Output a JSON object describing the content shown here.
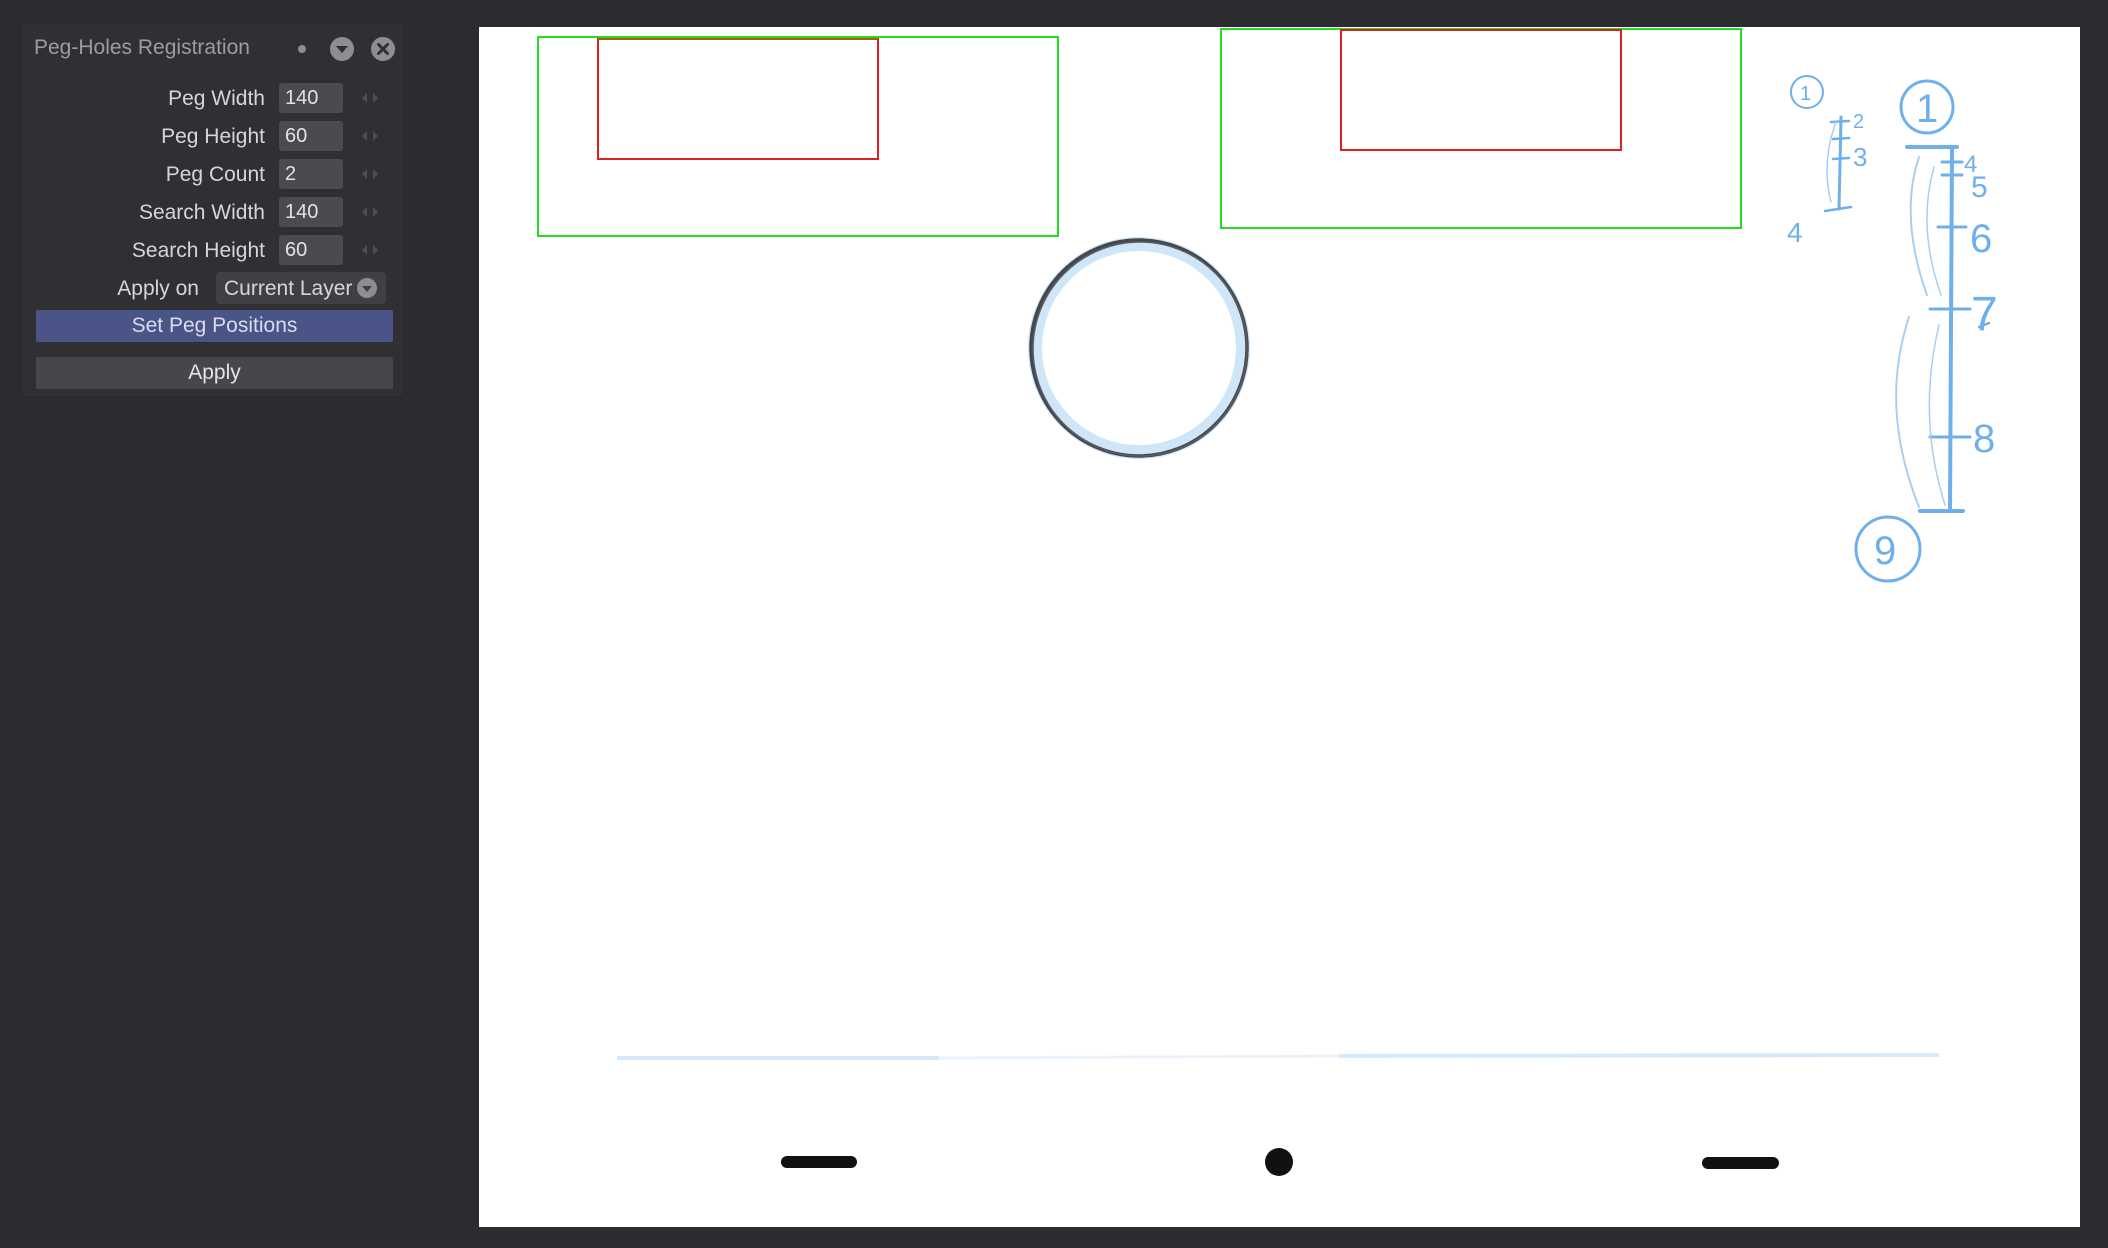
{
  "panel": {
    "title": "Peg-Holes Registration",
    "fields": [
      {
        "label": "Peg Width",
        "value": "140"
      },
      {
        "label": "Peg Height",
        "value": "60"
      },
      {
        "label": "Peg Count",
        "value": "2"
      },
      {
        "label": "Search Width",
        "value": "140"
      },
      {
        "label": "Search Height",
        "value": "60"
      }
    ],
    "apply_on_label": "Apply on",
    "apply_on_value": "Current Layer",
    "set_peg_positions_label": "Set Peg Positions",
    "apply_label": "Apply",
    "icons": {
      "dot": "status-dot-icon",
      "collapse": "chevron-down-circle-icon",
      "close": "close-circle-icon",
      "handle": "drag-handle-icon"
    }
  },
  "canvas": {
    "drawing_labels_small": [
      "1",
      "2",
      "3",
      "4"
    ],
    "drawing_labels_large": [
      "1",
      "4",
      "5",
      "6",
      "7",
      "8",
      "9"
    ]
  },
  "colors": {
    "background": "#2b2b30",
    "panel": "#2f2f34",
    "accent_button": "#4a5486",
    "search_box": "#22dd22",
    "peg_box": "#e02020",
    "sketch_blue": "#6fb0ea"
  }
}
